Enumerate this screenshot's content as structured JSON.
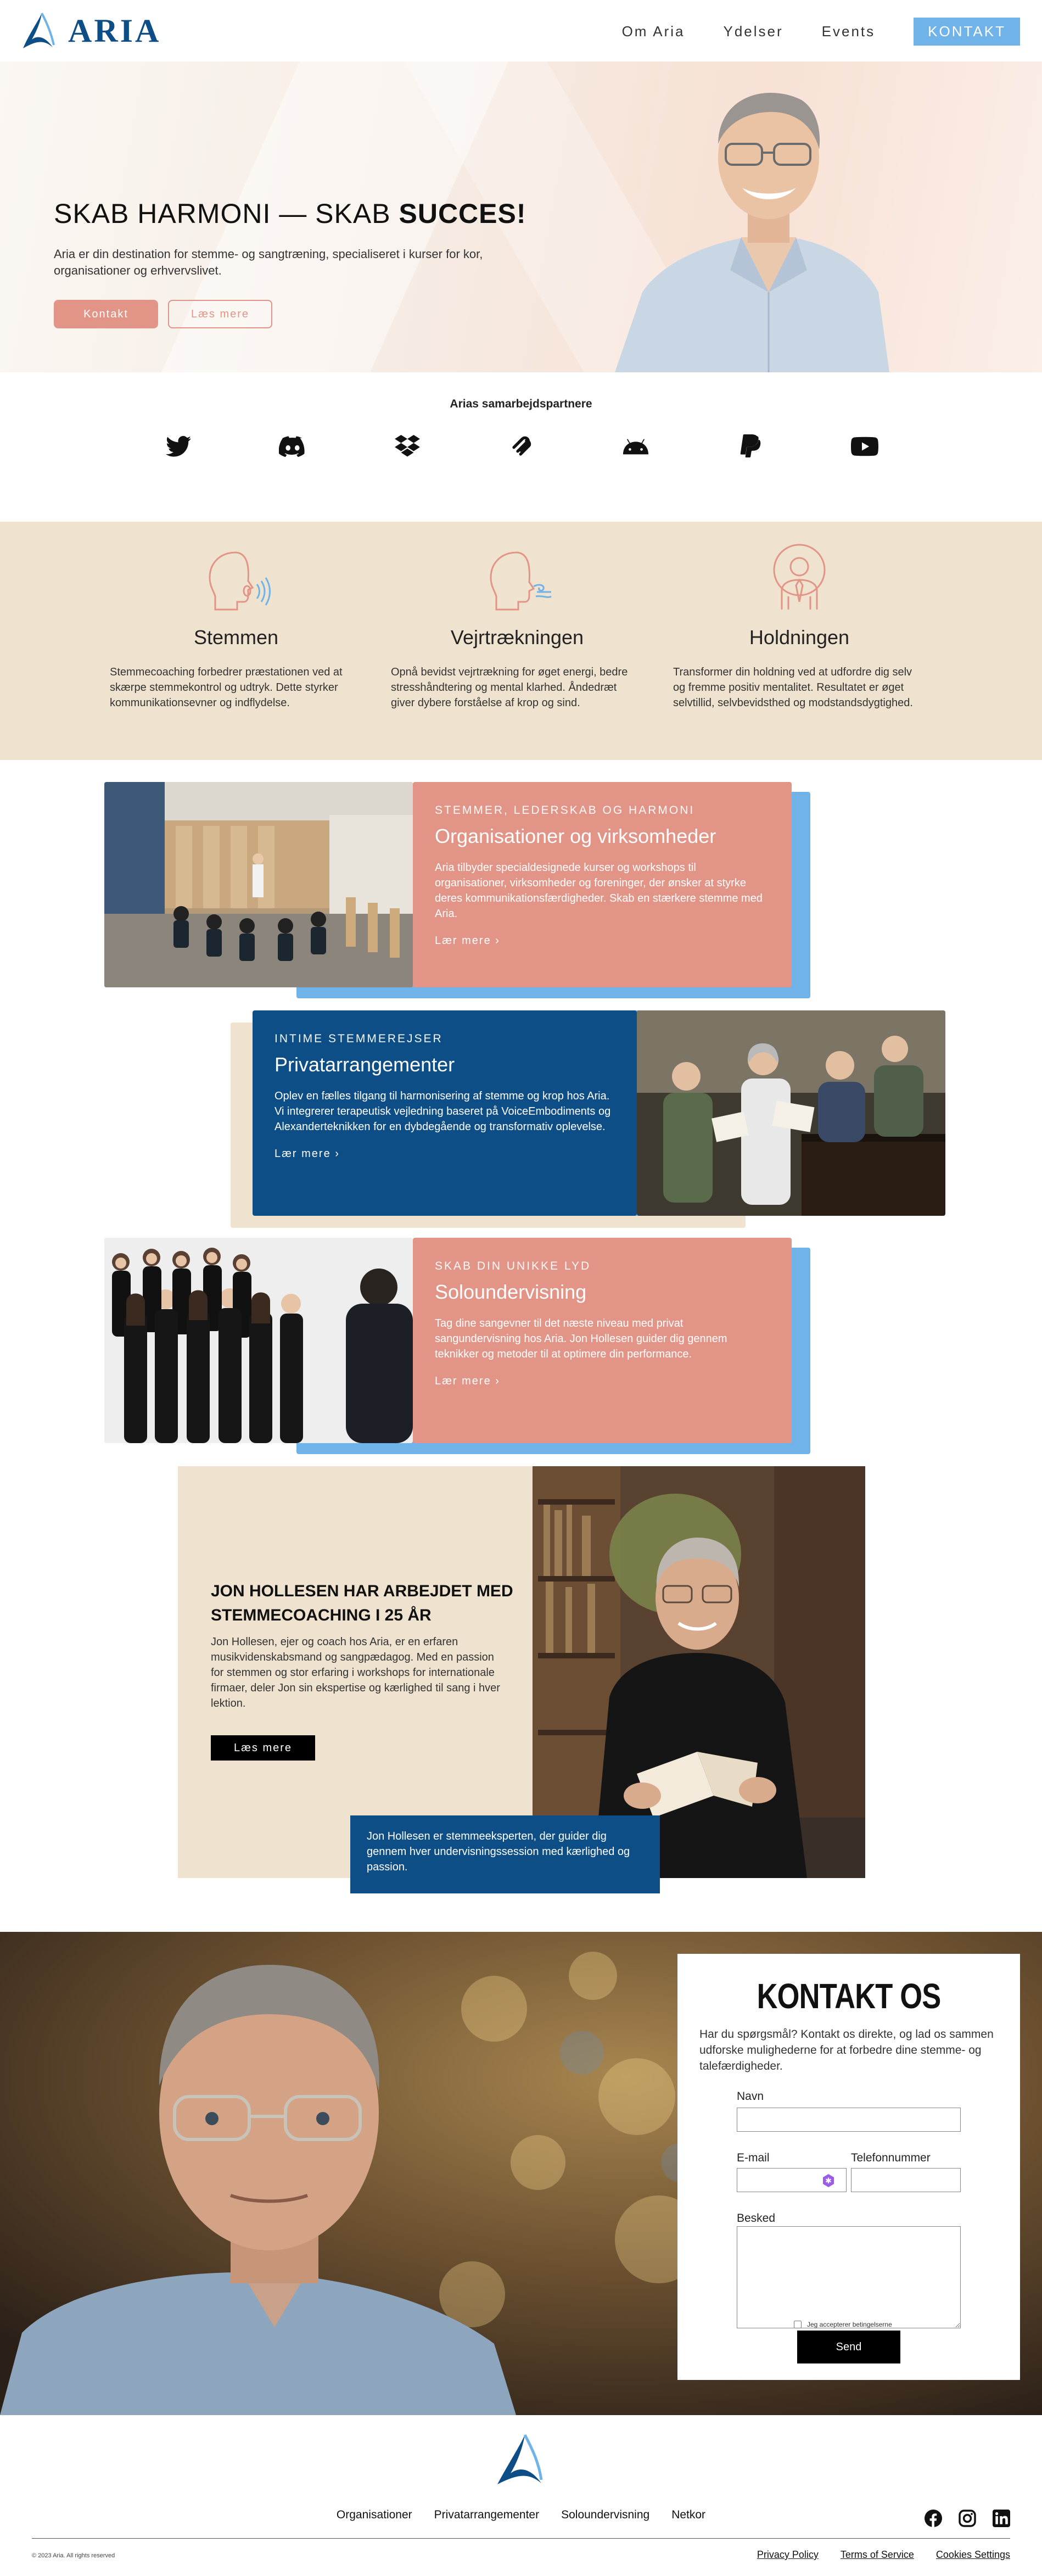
{
  "brand": {
    "name": "ARIA"
  },
  "nav": {
    "items": [
      "Om Aria",
      "Ydelser",
      "Events"
    ],
    "cta": "KONTAKT"
  },
  "hero": {
    "title_plain": "SKAB HARMONI — SKAB ",
    "title_bold": "SUCCES!",
    "text": "Aria er din destination for stemme- og sangtræning, specialiseret i kurser for kor, organisationer og erhvervslivet.",
    "btn_primary": "Kontakt",
    "btn_secondary": "Læs mere"
  },
  "partners": {
    "title": "Arias samarbejdspartnere",
    "icons": [
      "twitter-icon",
      "discord-icon",
      "dropbox-icon",
      "squarespace-icon",
      "android-icon",
      "paypal-icon",
      "youtube-icon"
    ]
  },
  "services": [
    {
      "title": "Stemmen",
      "icon": "singing-head-icon",
      "text": "Stemmecoaching forbedrer præstationen ved at skærpe stemmekontrol og udtryk. Dette styrker kommunikationsevner og indflydelse."
    },
    {
      "title": "Vejrtrækningen",
      "icon": "breathing-head-icon",
      "text": "Opnå bevidst vejrtrækning for øget energi, bedre stresshåndtering og mental klarhed. Åndedræt giver dybere forståelse af krop og sind."
    },
    {
      "title": "Holdningen",
      "icon": "posture-person-icon",
      "text": "Transformer din holdning ved at udfordre dig selv og fremme positiv mentalitet. Resultatet er øget selvtillid, selvbevidsthed og modstandsdygtighed."
    }
  ],
  "features": [
    {
      "eyebrow": "STEMMER, LEDERSKAB OG HARMONI",
      "title": "Organisationer og virksomheder",
      "text": "Aria tilbyder specialdesignede kurser og workshops til organisationer, virksomheder og foreninger, der ønsker at styrke deres kommunikationsfærdigheder. Skab en stærkere stemme med Aria.",
      "more": "Lær mere"
    },
    {
      "eyebrow": "INTIME STEMMEREJSER",
      "title": "Privatarrangementer",
      "text": "Oplev en fælles tilgang til harmonisering af stemme og krop hos Aria. Vi integrerer terapeutisk vejledning baseret på VoiceEmbodiments og Alexanderteknikken for en dybdegående og transformativ oplevelse.",
      "more": "Lær mere"
    },
    {
      "eyebrow": "SKAB DIN UNIKKE LYD",
      "title": "Soloundervisning",
      "text": "Tag dine sangevner til det næste niveau med privat sangundervisning hos Aria. Jon Hollesen guider dig gennem teknikker og metoder til at optimere din performance.",
      "more": "Lær mere"
    }
  ],
  "jon": {
    "title": "JON HOLLESEN HAR ARBEJDET MED STEMMECOACHING I 25 ÅR",
    "text": "Jon Hollesen, ejer og coach hos Aria, er en erfaren musikvidenskabsmand og sangpædagog. Med en passion for stemmen og stor erfaring i workshops for internationale firmaer, deler Jon sin ekspertise og kærlighed til sang i hver lektion.",
    "button": "Læs mere",
    "caption": "Jon Hollesen er stemmeeksperten, der guider dig gennem hver undervisningssession med kærlighed og passion."
  },
  "contact": {
    "title": "KONTAKT OS",
    "lead": "Har du spørgsmål? Kontakt os direkte, og lad os sammen udforske mulighederne for at forbedre dine stemme- og talefærdigheder.",
    "name_label": "Navn",
    "email_label": "E-mail",
    "phone_label": "Telefonnummer",
    "message_label": "Besked",
    "consent": "Jeg accepterer betingelserne",
    "send": "Send"
  },
  "footer": {
    "nav": [
      "Organisationer",
      "Privatarrangementer",
      "Soloundervisning",
      "Netkor"
    ],
    "copyright": "© 2023 Aria. All rights reserved",
    "legal": [
      "Privacy Policy",
      "Terms of Service",
      "Cookies Settings"
    ],
    "social": [
      "facebook-icon",
      "instagram-icon",
      "linkedin-icon"
    ]
  },
  "colors": {
    "brand_blue": "#0e4e86",
    "sky": "#6fb3e8",
    "coral": "#e29487",
    "sand": "#efe2cf"
  }
}
